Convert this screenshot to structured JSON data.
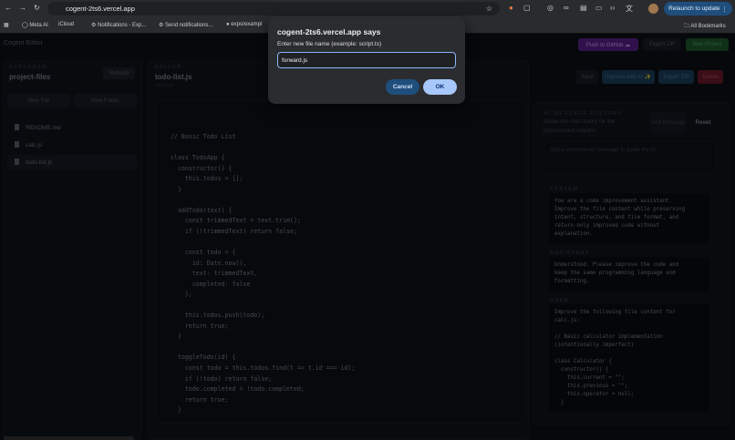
{
  "browser": {
    "url": "cogent-2ts6.vercel.app",
    "relaunch": "Relaunch to update",
    "bookmarks": [
      "Meta AI",
      "iCloud",
      "Notifications - Exp...",
      "Send notifications...",
      "expo/exampl"
    ],
    "all_bookmarks": "All Bookmarks"
  },
  "app": {
    "name": "Cogent Editor",
    "push_github": "Push to GitHub ☁",
    "export_zip": "Export ZIP",
    "new_project": "New Project"
  },
  "explorer": {
    "label": "EXPLORER",
    "title": "project-files",
    "refresh": "Refresh",
    "new_file": "New File",
    "new_folder": "New Folder",
    "files": [
      "README.md",
      "calc.js",
      "todo-list.js"
    ],
    "active": "todo-list.js"
  },
  "editor": {
    "label": "EDITOR",
    "title": "todo-list.js",
    "subtitle": "todo-list.js",
    "save": "Save",
    "improve": "Improve with AI ✨",
    "export_zip": "Export ZIP",
    "delete": "Delete",
    "code": "// Basic Todo List\n\nclass TodoApp {\n  constructor() {\n    this.todos = [];\n  }\n\n  addTodo(text) {\n    const trimmedText = text.trim();\n    if (!trimmedText) return false;\n\n    const todo = {\n      id: Date.now(),\n      text: trimmedText,\n      completed: false\n    };\n\n    this.todos.push(todo);\n    return true;\n  }\n\n  toggleTodo(id) {\n    const todo = this.todos.find(t => t.id === id);\n    if (!todo) return false;\n    todo.completed = !todo.completed;\n    return true;\n  }"
  },
  "ai": {
    "label": "AI MESSAGE HISTORY",
    "desc": "Keeps the chat history for the improvement request.",
    "add": "Add Message",
    "reset": "Reset",
    "placeholder": "Add a system/user message to guide the AI...",
    "messages": [
      {
        "role": "SYSTEM",
        "text": "You are a code improvement assistant.\nImprove the file content while preserving\nintent, structure, and file format, and\nreturn only improved code without\nexplanation."
      },
      {
        "role": "ASSISTANT",
        "text": "Understood. Please improve the code and\nkeep the same programming language and\nformatting."
      },
      {
        "role": "USER",
        "text": "Improve the following file content for\ncalc.js:\n\n// Basic calculator implementation\n(intentionally imperfect)\n\nclass Calculator {\n  constructor() {\n    this.current = \"\";\n    this.previous = \"\";\n    this.operator = null;\n  }"
      }
    ]
  },
  "dialog": {
    "title": "cogent-2ts6.vercel.app says",
    "prompt": "Enter new file name (example: script.ts)",
    "value": "forward.js",
    "cancel": "Cancel",
    "ok": "OK"
  }
}
